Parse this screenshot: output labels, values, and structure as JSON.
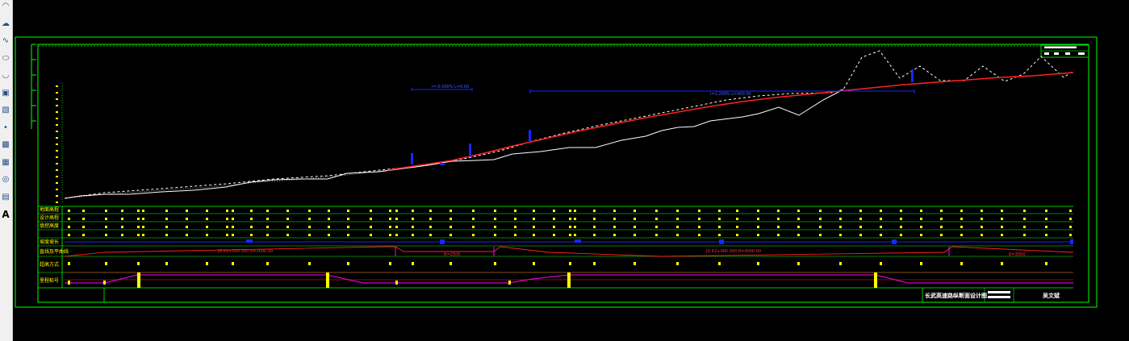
{
  "toolbar": {
    "tools": [
      {
        "name": "arc-tool-icon",
        "glyph": "◠"
      },
      {
        "name": "revcloud-tool-icon",
        "glyph": "☁"
      },
      {
        "name": "spline-tool-icon",
        "glyph": "∿"
      },
      {
        "name": "ellipse-tool-icon",
        "glyph": "⬭"
      },
      {
        "name": "ellipse-arc-tool-icon",
        "glyph": "◡"
      },
      {
        "name": "insert-block-icon",
        "glyph": "▣"
      },
      {
        "name": "make-block-icon",
        "glyph": "▧"
      },
      {
        "name": "point-tool-icon",
        "glyph": "•"
      },
      {
        "name": "hatch-tool-icon",
        "glyph": "▩"
      },
      {
        "name": "gradient-tool-icon",
        "glyph": "▦"
      },
      {
        "name": "region-tool-icon",
        "glyph": "◎"
      },
      {
        "name": "table-tool-icon",
        "glyph": "▤"
      },
      {
        "name": "mtext-tool-icon",
        "glyph": "A"
      }
    ]
  },
  "drawing": {
    "title_block_name": "长武高速路纵断面设计图",
    "designer_label": "吴文斌",
    "slope_label_1": "i=-0.500% L=0.00",
    "slope_label_2": "i=1.200% L=400.00",
    "curve_label_1": "JD K0+500.000 R=3000.00",
    "curve_label_2": "JD K2+900.000 R=4000.00",
    "curve_label_3": "R=2500",
    "curve_label_4": "R=3000"
  },
  "profile_table": {
    "row_labels": [
      "地面高程",
      "设计高程",
      "填挖高度",
      "坡度坡长",
      "直线及平曲线",
      "超高方式",
      "里程桩号"
    ]
  },
  "colors": {
    "frame": "#00ff00",
    "ground": "#ffffff",
    "design": "#ff2020",
    "annotation": "#1428ff",
    "text": "#ffff00",
    "curve": "#ff00ff"
  }
}
